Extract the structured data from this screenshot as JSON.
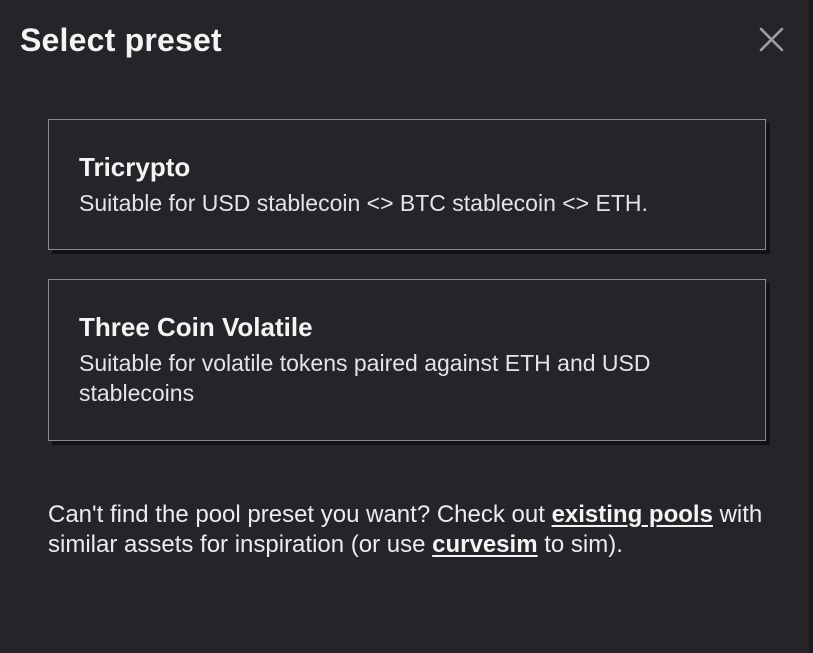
{
  "modal": {
    "title": "Select preset",
    "close_icon": "close-icon"
  },
  "presets": [
    {
      "name": "Tricrypto",
      "description": "Suitable for USD stablecoin <> BTC stablecoin <> ETH."
    },
    {
      "name": "Three Coin Volatile",
      "description": "Suitable for volatile tokens paired against ETH and USD stablecoins"
    }
  ],
  "footer": {
    "text_before": "Can't find the pool preset you want? Check out ",
    "existing_pools_link": "existing pools",
    "text_middle": " with similar assets for inspiration (or use ",
    "curvesim_link": "curvesim",
    "text_after": " to sim)."
  },
  "colors": {
    "background": "#252429",
    "border": "#8a8990",
    "text": "#f2f2f2"
  }
}
